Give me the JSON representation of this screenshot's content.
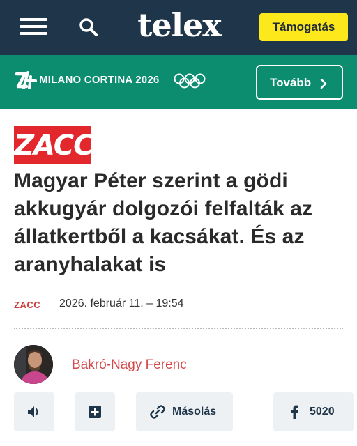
{
  "header": {
    "logo_text": "telex",
    "support_label": "Támogatás"
  },
  "banner": {
    "brand_text": "MILANO CORTINA 2026",
    "more_label": "Tovább",
    "colors": {
      "background": "#0d8d70"
    }
  },
  "article": {
    "section_logo": "ZACC",
    "headline": "Magyar Péter szerint a gödi akkugyár dolgozói felfalták az állatkertből a kacsákat. És az aranyhalakat is",
    "section": "ZACC",
    "date": "2026. február 11. – 19:54",
    "author": "Bakró-Nagy Ferenc"
  },
  "actions": {
    "copy_label": "Másolás",
    "facebook_count": "5020"
  },
  "icons": [
    "hamburger-menu-icon",
    "search-icon",
    "milano-cortina-logo-icon",
    "olympic-rings-icon",
    "chevron-right-icon",
    "speaker-icon",
    "plus-icon",
    "link-icon",
    "facebook-icon"
  ],
  "colors": {
    "header_bg": "#1f3549",
    "support_btn": "#fce81b",
    "zacc_red": "#e2282d",
    "author_red": "#d5484a",
    "action_bg": "#eef1f4"
  }
}
